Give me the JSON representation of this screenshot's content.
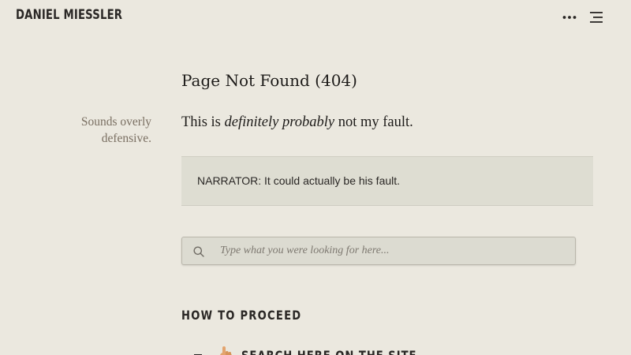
{
  "header": {
    "site_title": "DANIEL MIESSLER",
    "more_icon": "ellipsis-icon",
    "menu_icon": "hamburger-menu-icon"
  },
  "main": {
    "page_title": "Page Not Found (404)",
    "sidenote": "Sounds overly defensive.",
    "intro": {
      "before": "This is ",
      "emphasis": "definitely probably",
      "after": " not my fault."
    },
    "narrator_text": "NARRATOR: It could actually be his fault.",
    "search": {
      "placeholder": "Type what you were looking for here...",
      "value": "",
      "icon": "search-icon"
    },
    "how_to_proceed": {
      "heading": "HOW TO PROCEED",
      "items": [
        {
          "icon": "pointing-hand-icon",
          "label": "SEARCH HERE ON THE SITE"
        }
      ]
    }
  },
  "colors": {
    "background": "#ebe8df",
    "callout_background": "#deddd2",
    "text": "#1d1b19",
    "muted_text": "#7a6f62",
    "hand_icon": "#e3a46e"
  }
}
